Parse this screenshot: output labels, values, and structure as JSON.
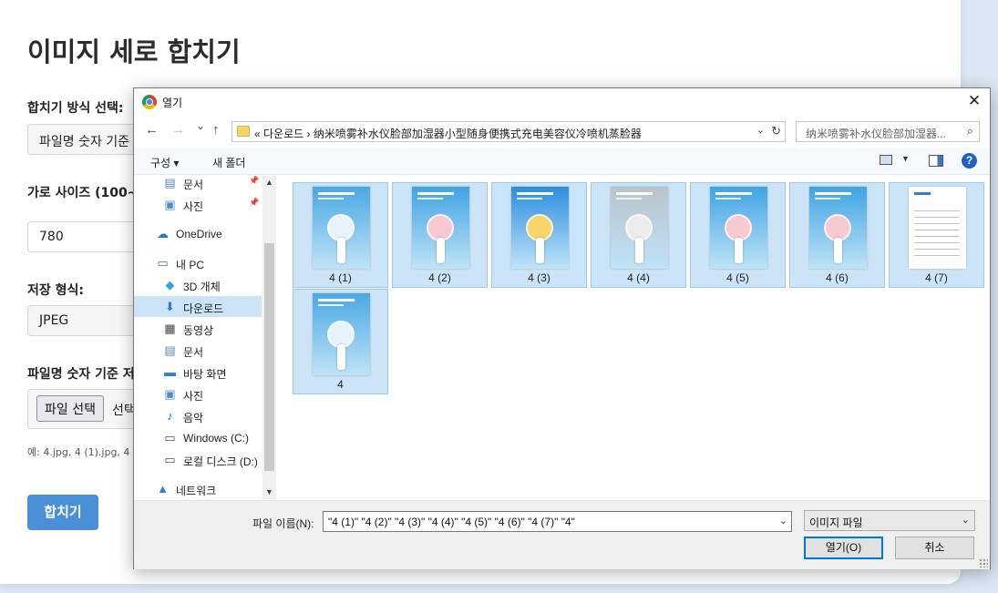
{
  "page": {
    "title": "이미지 세로 합치기",
    "merge_method_label": "합치기 방식 선택:",
    "merge_method_value": "파일명 숫자 기준",
    "width_label": "가로 사이즈 (100~",
    "width_value": "780",
    "format_label": "저장 형식:",
    "format_value": "JPEG",
    "file_section_label": "파일명 숫자 기준 저",
    "file_button": "파일 선택",
    "file_status": "선택",
    "hint": "예: 4.jpg, 4 (1).jpg, 4",
    "merge_button": "합치기"
  },
  "dialog": {
    "title": "열기",
    "close": "✕",
    "nav": {
      "back": "←",
      "forward": "→",
      "recent": "⌄",
      "up": "↑"
    },
    "breadcrumb": "«  다운로드  ›  纳米喷雾补水仪脸部加湿器小型随身便携式充电美容仪冷喷机蒸脸器",
    "search_placeholder": "纳米喷雾补水仪脸部加湿器...",
    "toolbar": {
      "organize": "구성 ▾",
      "new_folder": "새 폴더",
      "help": "?"
    },
    "sidebar": [
      {
        "label": "문서",
        "icon": "document-icon",
        "glyph": "▤",
        "pinned": true
      },
      {
        "label": "사진",
        "icon": "picture-icon",
        "glyph": "▣",
        "pinned": true
      },
      {
        "label": "OneDrive",
        "icon": "cloud-icon",
        "glyph": "☁",
        "pinned": false
      },
      {
        "label": "내 PC",
        "icon": "computer-icon",
        "glyph": "▭",
        "pinned": false
      },
      {
        "label": "3D 개체",
        "icon": "cube-icon",
        "glyph": "◆",
        "pinned": false
      },
      {
        "label": "다운로드",
        "icon": "download-icon",
        "glyph": "⬇",
        "pinned": false,
        "selected": true
      },
      {
        "label": "동영상",
        "icon": "video-icon",
        "glyph": "▦",
        "pinned": false
      },
      {
        "label": "문서",
        "icon": "document-icon",
        "glyph": "▤",
        "pinned": false
      },
      {
        "label": "바탕 화면",
        "icon": "desktop-icon",
        "glyph": "▬",
        "pinned": false
      },
      {
        "label": "사진",
        "icon": "picture-icon",
        "glyph": "▣",
        "pinned": false
      },
      {
        "label": "음악",
        "icon": "music-icon",
        "glyph": "♪",
        "pinned": false
      },
      {
        "label": "Windows (C:)",
        "icon": "drive-icon",
        "glyph": "▭",
        "pinned": false
      },
      {
        "label": "로컬 디스크 (D:)",
        "icon": "drive-icon",
        "glyph": "▭",
        "pinned": false
      },
      {
        "label": "네트워크",
        "icon": "network-icon",
        "glyph": "▲",
        "pinned": false
      }
    ],
    "files": [
      {
        "name": "4 (1)",
        "theme": "fan-white"
      },
      {
        "name": "4 (2)",
        "theme": "fan-pink"
      },
      {
        "name": "4 (3)",
        "theme": "fan-yellow"
      },
      {
        "name": "4 (4)",
        "theme": "fan-gray"
      },
      {
        "name": "4 (5)",
        "theme": "fan-pink"
      },
      {
        "name": "4 (6)",
        "theme": "fan-pink"
      },
      {
        "name": "4 (7)",
        "theme": "spec-sheet"
      },
      {
        "name": "4",
        "theme": "fan-white"
      }
    ],
    "filename_label": "파일 이름(N):",
    "filename_value": "\"4 (1)\" \"4 (2)\" \"4 (3)\" \"4 (4)\" \"4 (5)\" \"4 (6)\" \"4 (7)\" \"4\"",
    "filetype_value": "이미지 파일",
    "open_button": "열기(O)",
    "cancel_button": "취소"
  }
}
